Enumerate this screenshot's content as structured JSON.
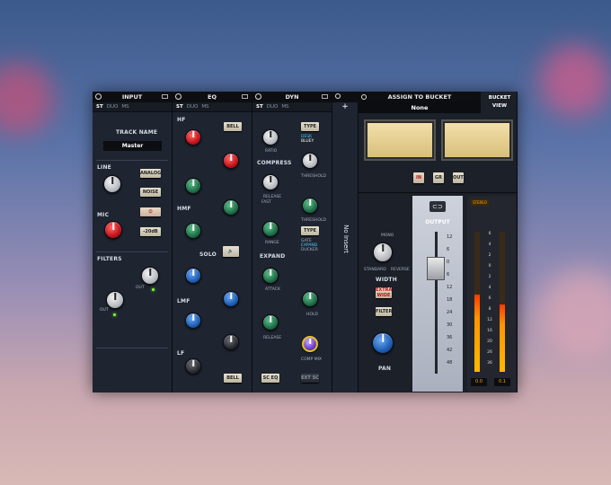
{
  "input": {
    "title": "INPUT",
    "modes": [
      "ST",
      "DUO",
      "MS"
    ],
    "track_name_label": "TRACK NAME",
    "track_name": "Master",
    "line_label": "LINE",
    "mic_label": "MIC",
    "filters_label": "FILTERS",
    "analog": "ANALOG",
    "noise": "NOISE",
    "pad": "-20dB",
    "hp_label": "OUT",
    "lp_label": "OUT"
  },
  "eq": {
    "title": "EQ",
    "modes": [
      "ST",
      "DUO",
      "MS"
    ],
    "hf": "HF",
    "hmf": "HMF",
    "lmf": "LMF",
    "lf": "LF",
    "solo": "SOLO",
    "bell": "BELL"
  },
  "dyn": {
    "title": "DYN",
    "modes": [
      "ST",
      "DUO",
      "MS"
    ],
    "type": "TYPE",
    "ratio": "RATIO",
    "desk": "DESK",
    "bluey": "BLUEY",
    "compress": "COMPRESS",
    "threshold": "THRESHOLD",
    "release": "RELEASE",
    "fast": "FAST",
    "range": "RANGE",
    "gate": "GATE",
    "expand_mode": "EXPAND",
    "ducker": "DUCKER",
    "expand": "EXPAND",
    "attack": "ATTACK",
    "hold": "HOLD",
    "release2": "RELEASE",
    "comp_mix": "COMP MIX",
    "sc_eq": "SC EQ",
    "ext_sc": "EXT SC"
  },
  "insert": {
    "label": "No Insert",
    "add": "+"
  },
  "bucket": {
    "title": "ASSIGN TO BUCKET",
    "value": "None",
    "view": "BUCKET VIEW",
    "in": "IN",
    "gr": "GR",
    "out": "OUT"
  },
  "output": {
    "mono": "MONO",
    "standard": "STANDARD",
    "reverse": "REVERSE",
    "width": "WIDTH",
    "extra_wide": "EXTRA WIDE",
    "filter": "FILTER",
    "pan": "PAN",
    "label": "OUTPUT",
    "scale": [
      "12",
      "6",
      "0",
      "6",
      "12",
      "18",
      "24",
      "30",
      "36",
      "42",
      "48"
    ],
    "readout_left": "0.0",
    "readout_right": "0.1"
  },
  "meters": {
    "stereo": "STEREO",
    "scale": [
      "6",
      "4",
      "2",
      "0",
      "2",
      "4",
      "6",
      "8",
      "12",
      "16",
      "20",
      "26",
      "36"
    ],
    "level_left": 0.55,
    "level_right": 0.48
  }
}
